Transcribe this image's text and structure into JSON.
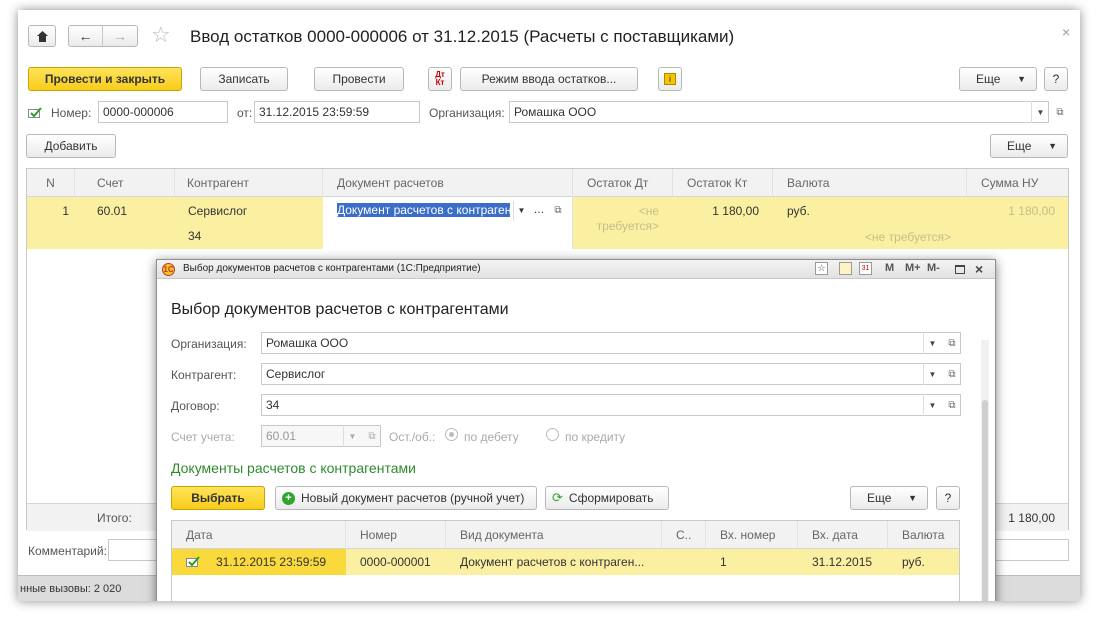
{
  "window": {
    "title": "Ввод остатков 0000-000006 от 31.12.2015 (Расчеты с поставщиками)",
    "close_glyph": "×"
  },
  "toolbar": {
    "post_close": "Провести и закрыть",
    "save": "Записать",
    "post": "Провести",
    "dtkt": "Дт\nКт",
    "mode": "Режим ввода остатков...",
    "more": "Еще",
    "help": "?"
  },
  "header": {
    "number_label": "Номер:",
    "number_value": "0000-000006",
    "date_label": "от:",
    "date_value": "31.12.2015 23:59:59",
    "org_label": "Организация:",
    "org_value": "Ромашка ООО"
  },
  "table_toolbar": {
    "add": "Добавить",
    "more": "Еще"
  },
  "table": {
    "columns": [
      "N",
      "Счет",
      "Контрагент",
      "Документ расчетов",
      "Остаток Дт",
      "Остаток Кт",
      "Валюта",
      "Сумма НУ"
    ],
    "row": {
      "n": "1",
      "account": "60.01",
      "contractor": "Сервислог",
      "contract": "34",
      "document": "Документ расчетов с контраген",
      "ostatok_dt": "<не требуется>",
      "ostatok_kt": "1 180,00",
      "currency": "руб.",
      "currency_note": "<не требуется>",
      "sum_nu": "1 180,00"
    },
    "footer_label": "Итого:",
    "footer_sum": "1 180,00"
  },
  "comment_label": "Комментарий:",
  "status": "нные вызовы: 2 020",
  "popup": {
    "titlebar": "Выбор документов расчетов с контрагентами (1С:Предприятие)",
    "title": "Выбор документов расчетов с контрагентами",
    "tb_icons": [
      "М",
      "М+",
      "М-"
    ],
    "org_label": "Организация:",
    "org_value": "Ромашка ООО",
    "contractor_label": "Контрагент:",
    "contractor_value": "Сервислог",
    "contract_label": "Договор:",
    "contract_value": "34",
    "account_label": "Счет учета:",
    "account_value": "60.01",
    "ostob_label": "Ост./об.:",
    "radio_debit": "по дебету",
    "radio_credit": "по кредиту",
    "section_title": "Документы расчетов с контрагентами",
    "choose": "Выбрать",
    "new_doc": "Новый документ расчетов (ручной учет)",
    "form": "Сформировать",
    "more": "Еще",
    "help": "?",
    "columns": [
      "Дата",
      "Номер",
      "Вид документа",
      "С..",
      "Вх. номер",
      "Вх. дата",
      "Валюта"
    ],
    "row": {
      "date": "31.12.2015 23:59:59",
      "number": "0000-000001",
      "doc_type": "Документ расчетов с контраген...",
      "c": "",
      "in_number": "1",
      "in_date": "31.12.2015",
      "currency": "руб."
    }
  }
}
